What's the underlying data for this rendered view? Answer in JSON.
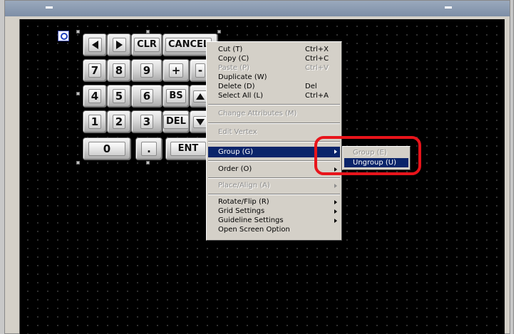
{
  "keypad": {
    "row1": [
      "CLR",
      "CANCEL"
    ],
    "row2": [
      "7",
      "8",
      "9",
      "+",
      "-"
    ],
    "row3": [
      "4",
      "5",
      "6",
      "BS"
    ],
    "row4": [
      "1",
      "2",
      "3",
      "DEL"
    ],
    "row5": [
      "0",
      ".",
      "ENT"
    ]
  },
  "context_menu": {
    "cut": {
      "label": "Cut (T)",
      "shortcut": "Ctrl+X"
    },
    "copy": {
      "label": "Copy (C)",
      "shortcut": "Ctrl+C"
    },
    "paste": {
      "label": "Paste (P)",
      "shortcut": "Ctrl+V"
    },
    "duplicate": {
      "label": "Duplicate (W)"
    },
    "delete": {
      "label": "Delete (D)",
      "shortcut": "Del"
    },
    "select_all": {
      "label": "Select All (L)",
      "shortcut": "Ctrl+A"
    },
    "change_attributes": {
      "label": "Change Attributes (M)"
    },
    "edit_vertex": {
      "label": "Edit Vertex"
    },
    "group": {
      "label": "Group (G)"
    },
    "order": {
      "label": "Order (O)"
    },
    "place_align": {
      "label": "Place/Align (A)"
    },
    "rotate_flip": {
      "label": "Rotate/Flip (R)"
    },
    "grid_settings": {
      "label": "Grid Settings"
    },
    "guideline_settings": {
      "label": "Guideline Settings"
    },
    "open_screen_option": {
      "label": "Open Screen Option"
    }
  },
  "submenu": {
    "group": {
      "label": "Group (E)"
    },
    "ungroup": {
      "label": "Ungroup (U)"
    }
  },
  "colors": {
    "menu_highlight": "#0a246a",
    "callout": "#e8141b",
    "canvas": "#000000"
  }
}
